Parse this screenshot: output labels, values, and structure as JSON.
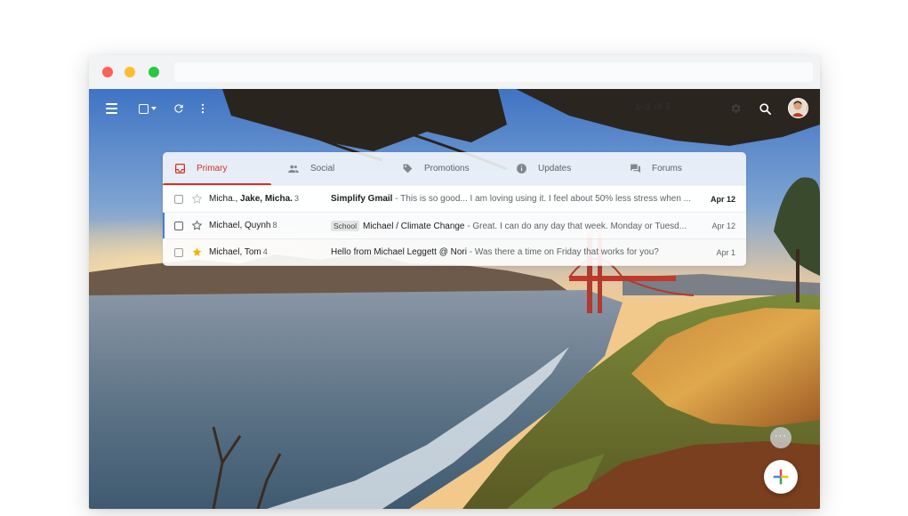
{
  "window": {
    "traffic_lights": [
      "close",
      "minimize",
      "maximize"
    ],
    "colors": {
      "close": "#ff5f57",
      "minimize": "#febc2e",
      "maximize": "#28c840"
    },
    "url": ""
  },
  "toolbar": {
    "icons": [
      "hamburger-menu-icon",
      "select-checkbox-icon",
      "refresh-icon",
      "more-vert-icon",
      "settings-icon",
      "search-icon"
    ],
    "page_count": "1–3 of 3"
  },
  "tabs": [
    {
      "label": "Primary",
      "icon": "inbox-icon",
      "active": true
    },
    {
      "label": "Social",
      "icon": "people-icon",
      "active": false
    },
    {
      "label": "Promotions",
      "icon": "tag-icon",
      "active": false
    },
    {
      "label": "Updates",
      "icon": "info-icon",
      "active": false
    },
    {
      "label": "Forums",
      "icon": "forum-icon",
      "active": false
    }
  ],
  "emails": [
    {
      "sender_a": "Micha., ",
      "sender_b": "Jake, Micha.",
      "count": "3",
      "label": "",
      "subject": "Simplify Gmail",
      "snippet": " - This is so good... I am loving using it. I feel about 50% less stress when ...",
      "date": "Apr 12",
      "starred": false,
      "unread": true
    },
    {
      "sender_a": "Michael, Quynh",
      "sender_b": "",
      "count": "8",
      "label": "School",
      "subject": "Michael / Climate Change",
      "snippet": " - Great. I can do any day that week. Monday or Tuesd...",
      "date": "Apr 12",
      "starred": false,
      "unread": false
    },
    {
      "sender_a": "Michael, Tom",
      "sender_b": "",
      "count": "4",
      "label": "",
      "subject": "Hello from Michael Leggett @ Nori",
      "snippet": " - Was there a time on Friday that works for you?",
      "date": "Apr 1",
      "starred": true,
      "unread": false
    }
  ],
  "fabs": {
    "more": "···",
    "compose_icon": "plus-icon"
  },
  "colors": {
    "accent": "#d93025",
    "star": "#f4b400",
    "selected_bar": "#4a7bd0"
  }
}
